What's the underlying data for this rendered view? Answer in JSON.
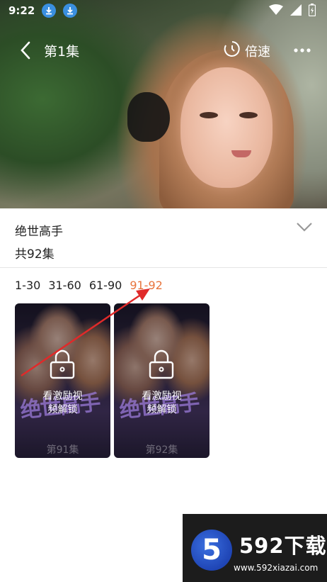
{
  "status_bar": {
    "time": "9:22"
  },
  "player": {
    "episode_title": "第1集",
    "speed_label": "倍速"
  },
  "drama": {
    "title": "绝世高手",
    "episode_count": "共92集"
  },
  "range_tabs": [
    {
      "label": "1-30",
      "active": false
    },
    {
      "label": "31-60",
      "active": false
    },
    {
      "label": "61-90",
      "active": false
    },
    {
      "label": "91-92",
      "active": true
    }
  ],
  "episodes": [
    {
      "unlock_line1": "看激励视",
      "unlock_line2": "频解锁",
      "label": "第91集",
      "poster_text": "绝世高手"
    },
    {
      "unlock_line1": "看激励视",
      "unlock_line2": "频解锁",
      "label": "第92集",
      "poster_text": "绝世高手"
    }
  ],
  "watermark": {
    "badge": "5",
    "title": "592下载",
    "url": "www.592xiazai.com"
  },
  "colors": {
    "active_tab": "#e8743c",
    "annotation_arrow": "#e02a2a"
  }
}
